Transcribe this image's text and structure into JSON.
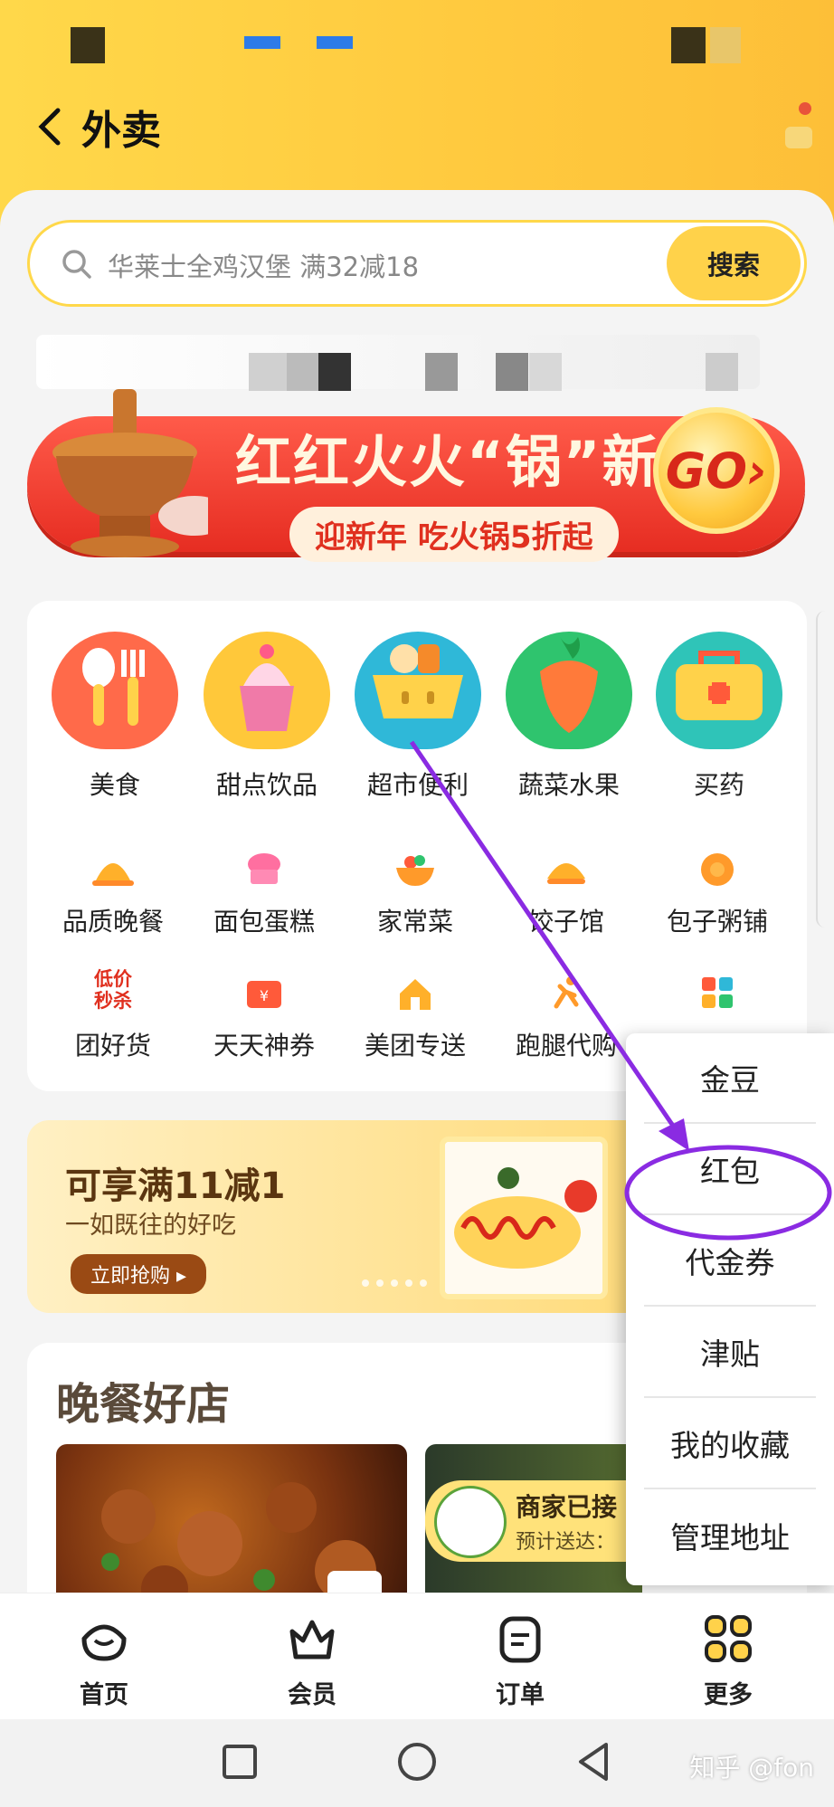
{
  "header": {
    "title": "外卖"
  },
  "search": {
    "placeholder": "华莱士全鸡汉堡 满32减18",
    "button": "搜索"
  },
  "banner": {
    "title": "红红火火“锅”新年",
    "subtitle": "迎新年 吃火锅5折起",
    "go": "GO"
  },
  "categories": {
    "big": [
      {
        "label": "美食",
        "color": "#ff6a4a"
      },
      {
        "label": "甜点饮品",
        "color": "#ffc83a"
      },
      {
        "label": "超市便利",
        "color": "#2fb8d8"
      },
      {
        "label": "蔬菜水果",
        "color": "#2fc46e"
      },
      {
        "label": "买药",
        "color": "#2fc4b8"
      }
    ],
    "row2": [
      "品质晚餐",
      "面包蛋糕",
      "家常菜",
      "饺子馆",
      "包子粥铺"
    ],
    "row3": [
      "团好货",
      "天天神券",
      "美团专送",
      "跑腿代购",
      ""
    ],
    "tuan_badge": [
      "低价",
      "秒杀"
    ]
  },
  "promo": {
    "title": "可享满11减1",
    "subtitle": "一如既往的好吃",
    "button": "立即抢购 ▸"
  },
  "dinner": {
    "title": "晚餐好店",
    "shop2_name": "商家已接",
    "shop2_eta": "预计送达："
  },
  "menu": {
    "items": [
      "金豆",
      "红包",
      "代金券",
      "津贴",
      "我的收藏",
      "管理地址"
    ],
    "highlighted": "红包"
  },
  "tabs": [
    "首页",
    "会员",
    "订单",
    "更多"
  ],
  "watermark": "知乎 @fon",
  "colors": {
    "brand_yellow": "#ffd24a",
    "annotation_purple": "#8a2be2"
  }
}
